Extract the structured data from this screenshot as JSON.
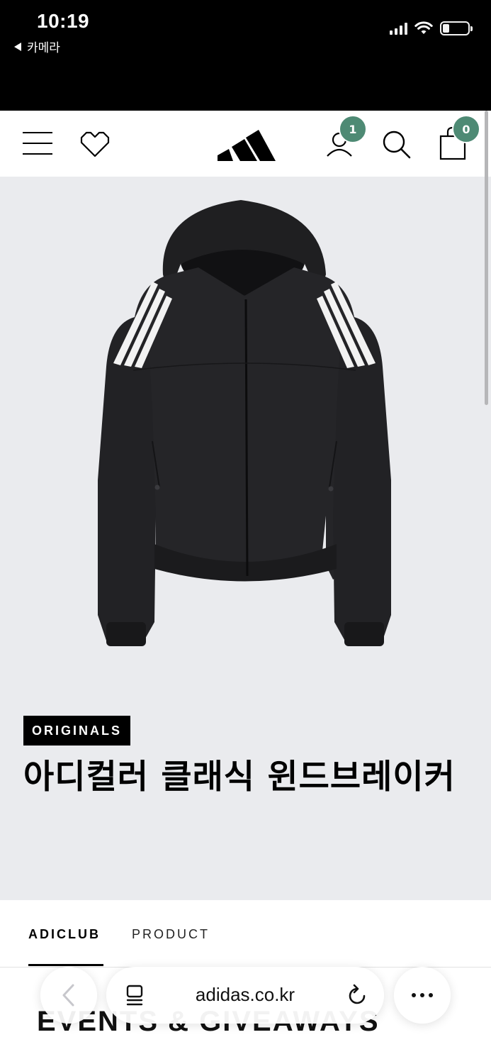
{
  "status_bar": {
    "time": "10:19",
    "back_app": "카메라"
  },
  "header": {
    "account_badge": "1",
    "bag_badge": "0",
    "accent_color": "#4e8a74"
  },
  "product": {
    "brand_tag": "ORIGINALS",
    "title": "아디컬러 클래식 윈드브레이커"
  },
  "tabs": [
    {
      "label": "ADICLUB",
      "active": true
    },
    {
      "label": "PRODUCT",
      "active": false
    }
  ],
  "section": {
    "heading": "EVENTS & GIVEAWAYS"
  },
  "browser": {
    "url": "adidas.co.kr"
  },
  "icons": [
    "menu-icon",
    "heart-icon",
    "adidas-logo",
    "account-icon",
    "search-icon",
    "bag-icon",
    "back-chevron-icon",
    "tabs-icon",
    "reload-icon",
    "more-icon"
  ]
}
